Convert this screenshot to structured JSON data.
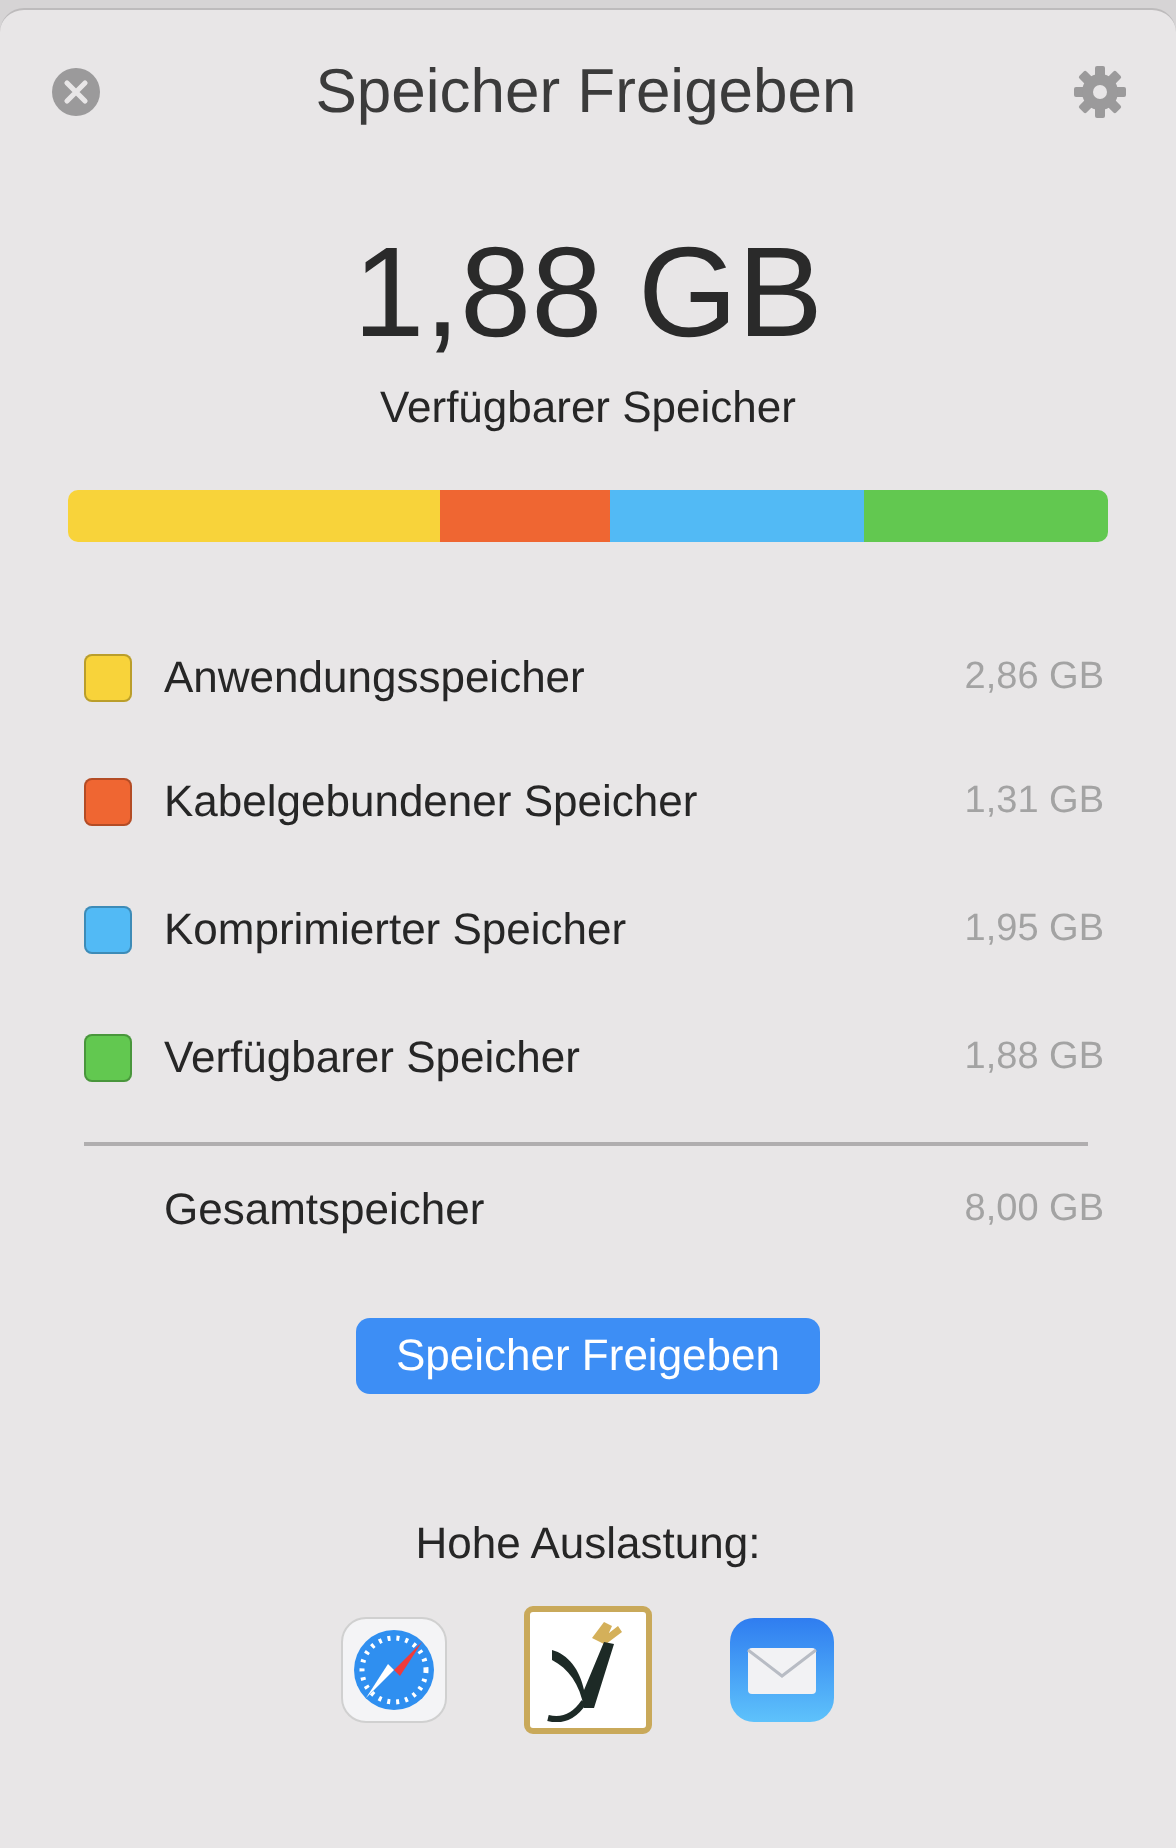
{
  "window": {
    "title": "Speicher Freigeben"
  },
  "summary": {
    "value": "1,88 GB",
    "label": "Verfügbarer Speicher"
  },
  "categories": [
    {
      "name": "Anwendungsspeicher",
      "amount": "2,86 GB",
      "color": "#f8d33a"
    },
    {
      "name": "Kabelgebundener Speicher",
      "amount": "1,31 GB",
      "color": "#ef6632"
    },
    {
      "name": "Komprimierter Speicher",
      "amount": "1,95 GB",
      "color": "#52baf5"
    },
    {
      "name": "Verfügbarer Speicher",
      "amount": "1,88 GB",
      "color": "#62c850"
    }
  ],
  "total": {
    "name": "Gesamtspeicher",
    "amount": "8,00 GB"
  },
  "action_button": "Speicher Freigeben",
  "high_usage": {
    "label": "Hohe Auslastung:",
    "apps": [
      {
        "kind": "compass"
      },
      {
        "kind": "monogram"
      },
      {
        "kind": "mail"
      }
    ]
  }
}
